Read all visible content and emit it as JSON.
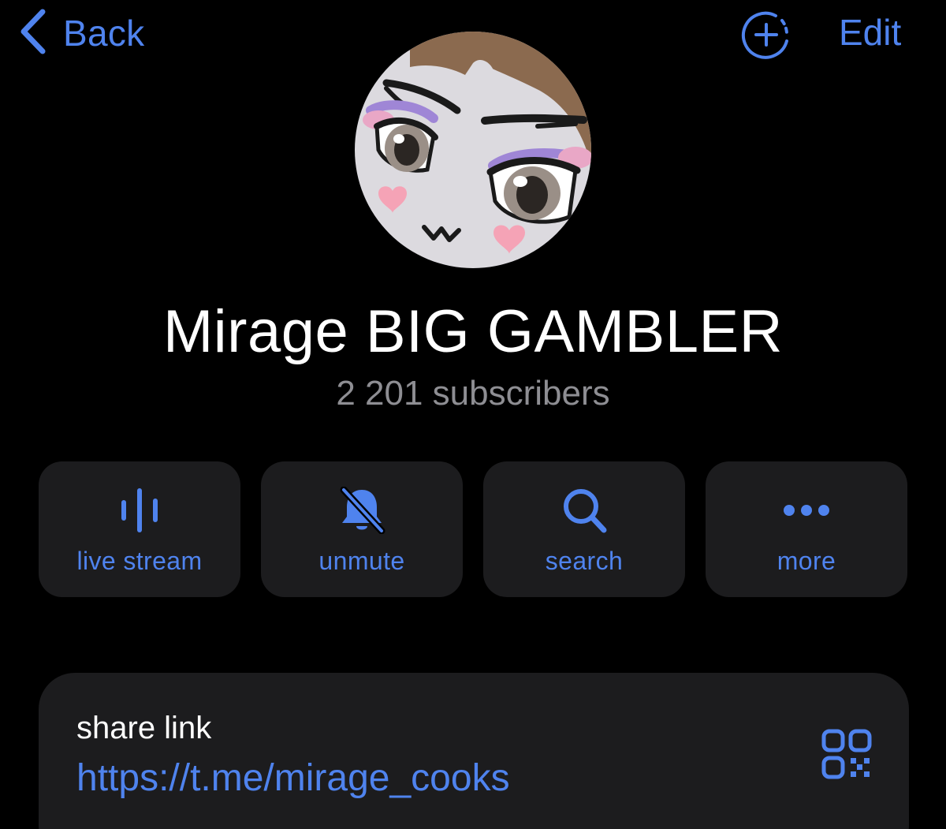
{
  "nav": {
    "back_label": "Back",
    "edit_label": "Edit"
  },
  "channel": {
    "name": "Mirage BIG GAMBLER",
    "subscribers": "2 201 subscribers"
  },
  "actions": [
    {
      "label": "live stream",
      "icon": "live-stream-icon"
    },
    {
      "label": "unmute",
      "icon": "bell-slash-icon"
    },
    {
      "label": "search",
      "icon": "search-icon"
    },
    {
      "label": "more",
      "icon": "more-dots-icon"
    }
  ],
  "share": {
    "title": "share link",
    "link": "https://t.me/mirage_cooks",
    "icon": "qr-code-icon"
  },
  "colors": {
    "background": "#000000",
    "card": "#1c1c1e",
    "accent": "#4f83ee",
    "secondary_text": "#8e8e93",
    "primary_text": "#ffffff"
  }
}
